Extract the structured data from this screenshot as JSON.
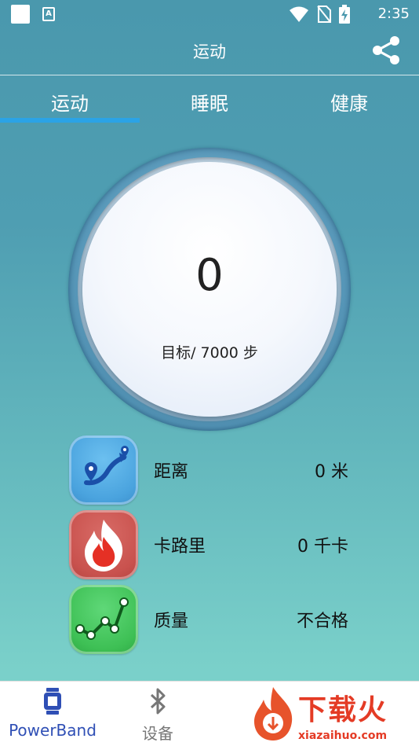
{
  "status_bar": {
    "time": "2:35",
    "icons": [
      "square-icon",
      "a-icon",
      "wifi-icon",
      "no-sim-icon",
      "battery-charging-icon"
    ]
  },
  "app_bar": {
    "title": "运动",
    "share_icon": "share-icon"
  },
  "tabs": [
    {
      "label": "运动",
      "active": true
    },
    {
      "label": "睡眠",
      "active": false
    },
    {
      "label": "健康",
      "active": false
    }
  ],
  "steps": {
    "value": "0",
    "goal_text": "目标/ 7000 步"
  },
  "stats": [
    {
      "label": "距离",
      "value": "0 米",
      "icon": "route-icon",
      "color": "#4aa3de"
    },
    {
      "label": "卡路里",
      "value": "0 千卡",
      "icon": "flame-icon",
      "color": "#c9524e"
    },
    {
      "label": "质量",
      "value": "不合格",
      "icon": "trend-line-icon",
      "color": "#3ec055"
    }
  ],
  "bottom_nav": [
    {
      "label": "PowerBand",
      "icon": "band-icon",
      "active": true
    },
    {
      "label": "设备",
      "icon": "bluetooth-icon",
      "active": false
    }
  ],
  "watermark": {
    "text": "下载火",
    "sub": "xiazaihuo.com"
  },
  "colors": {
    "accent": "#2ba3e6",
    "nav_active": "#2f4fb5",
    "nav_inactive": "#777777"
  }
}
